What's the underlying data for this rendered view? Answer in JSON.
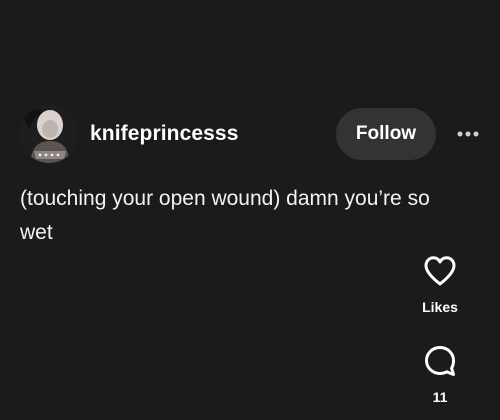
{
  "post": {
    "username": "knifeprincesss",
    "follow_label": "Follow",
    "text": "(touching your open wound) damn you’re so wet"
  },
  "actions": {
    "likes_label": "Likes",
    "comments_count": "11"
  },
  "icons": {
    "more": "more-horizontal-icon",
    "like": "heart-icon",
    "comment": "comment-bubble-icon"
  },
  "colors": {
    "background": "#1b1b1b",
    "follow_button_bg": "#333333",
    "text": "#ffffff"
  }
}
